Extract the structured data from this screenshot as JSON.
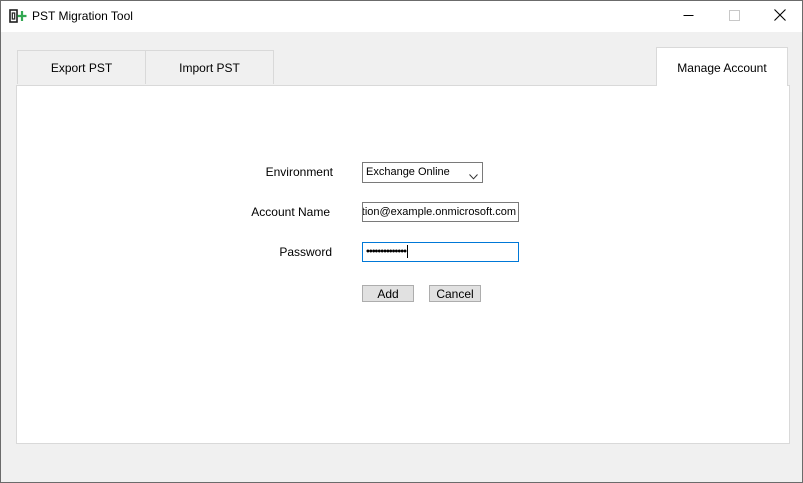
{
  "window": {
    "title": "PST Migration Tool",
    "icon": "outlook-add-icon"
  },
  "titlebar": {
    "minimize_icon": "minimize-icon",
    "maximize_icon": "maximize-icon",
    "close_icon": "close-icon"
  },
  "tabs": [
    {
      "label": "Export PST",
      "active": false
    },
    {
      "label": "Import PST",
      "active": false
    },
    {
      "label": "Manage Account",
      "active": true
    }
  ],
  "form": {
    "environment": {
      "label": "Environment",
      "value": "Exchange Online",
      "icon": "chevron-down-icon"
    },
    "account_name": {
      "label": "Account Name",
      "value": "ation@example.onmicrosoft.com"
    },
    "password": {
      "label": "Password",
      "value": "••••••••••••••"
    }
  },
  "buttons": {
    "add": "Add",
    "cancel": "Cancel"
  },
  "colors": {
    "accent": "#0078d7",
    "icon_green": "#33a852"
  }
}
